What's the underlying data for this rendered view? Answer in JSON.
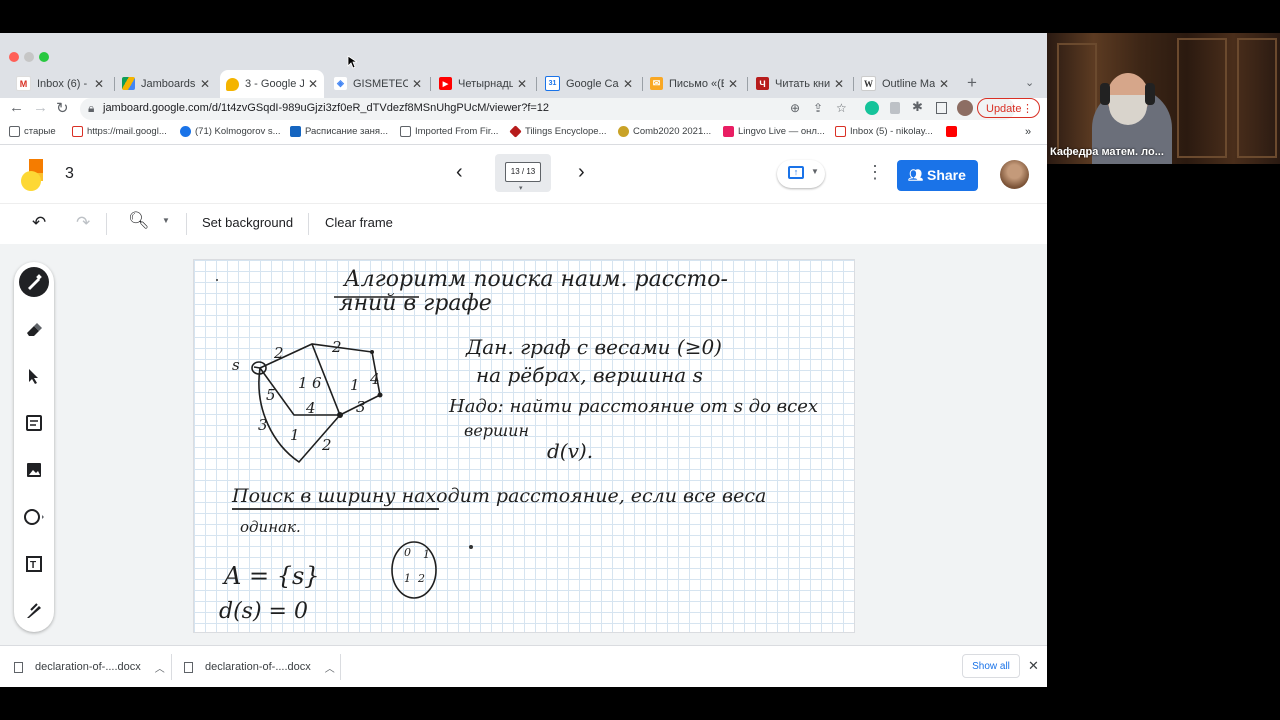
{
  "browser": {
    "tabs": [
      {
        "label": "Inbox (6) - nik",
        "favicon": "gmail-icon",
        "color": "#d93025"
      },
      {
        "label": "Jamboards - G",
        "favicon": "drive-icon",
        "color": "#1a73e8"
      },
      {
        "label": "3 - Google Ja",
        "favicon": "jamboard-icon",
        "color": "#f4b400",
        "active": true
      },
      {
        "label": "GISMETEO: По",
        "favicon": "gismeteo-icon",
        "color": "#4285f4"
      },
      {
        "label": "Четырнадцат",
        "favicon": "youtube-icon",
        "color": "#ff0000"
      },
      {
        "label": "Google Calend",
        "favicon": "calendar-icon",
        "color": "#1a73e8"
      },
      {
        "label": "Письмо «(Бе",
        "favicon": "mail-icon",
        "color": "#f9a825"
      },
      {
        "label": "Читать книгу",
        "favicon": "book-icon",
        "color": "#b71c1c"
      },
      {
        "label": "Outline Map o",
        "favicon": "wikipedia-icon",
        "color": "#333333"
      }
    ],
    "url": "jamboard.google.com/d/1t4zvGSqdI-989uGjzi3zf0eR_dTVdezf8MSnUhgPUcM/viewer?f=12",
    "update_label": "Update",
    "bookmarks": [
      {
        "label": "старые",
        "icon": "folder-icon"
      },
      {
        "label": "https://mail.googl...",
        "icon": "gmail-icon"
      },
      {
        "label": "(71) Kolmogorov s...",
        "icon": "people-icon"
      },
      {
        "label": "Расписание заня...",
        "icon": "doc-icon"
      },
      {
        "label": "Imported From Fir...",
        "icon": "folder-icon"
      },
      {
        "label": "Tilings Encyclope...",
        "icon": "tilings-icon"
      },
      {
        "label": "Comb2020 2021...",
        "icon": "comb-icon"
      },
      {
        "label": "Lingvo Live — онл...",
        "icon": "lingvo-icon"
      },
      {
        "label": "Inbox (5) - nikolay...",
        "icon": "gmail-icon"
      }
    ]
  },
  "jamboard": {
    "title": "3",
    "frame_counter": "13 / 13",
    "share_label": "Share",
    "toolbar": {
      "set_background": "Set background",
      "clear_frame": "Clear frame"
    }
  },
  "board": {
    "heading_line1": "Алгоритм поиска наим. рассто-",
    "heading_line2": "яний в графе",
    "given_line1": "Дан. граф с весами (≥0)",
    "given_line2": "на рёбрах, вершина s",
    "need_line1": "Надо: найти расстояние от s до всех",
    "need_line2": "вершин",
    "dv": "d(v).",
    "bfs_line": "Поиск в ширину находит расстояние, если все веса",
    "bfs_sub": "одинак.",
    "set_a": "A = {s}",
    "ds": "d(s) = 0",
    "graph_labels": [
      "s",
      "2",
      "2",
      "5",
      "1",
      "6",
      "1",
      "4",
      "4",
      "3",
      "3",
      "1",
      "2"
    ]
  },
  "downloads": {
    "items": [
      "declaration-of-....docx",
      "declaration-of-....docx"
    ],
    "show_all": "Show all"
  },
  "video": {
    "caption": "Кафедра матем. ло..."
  }
}
